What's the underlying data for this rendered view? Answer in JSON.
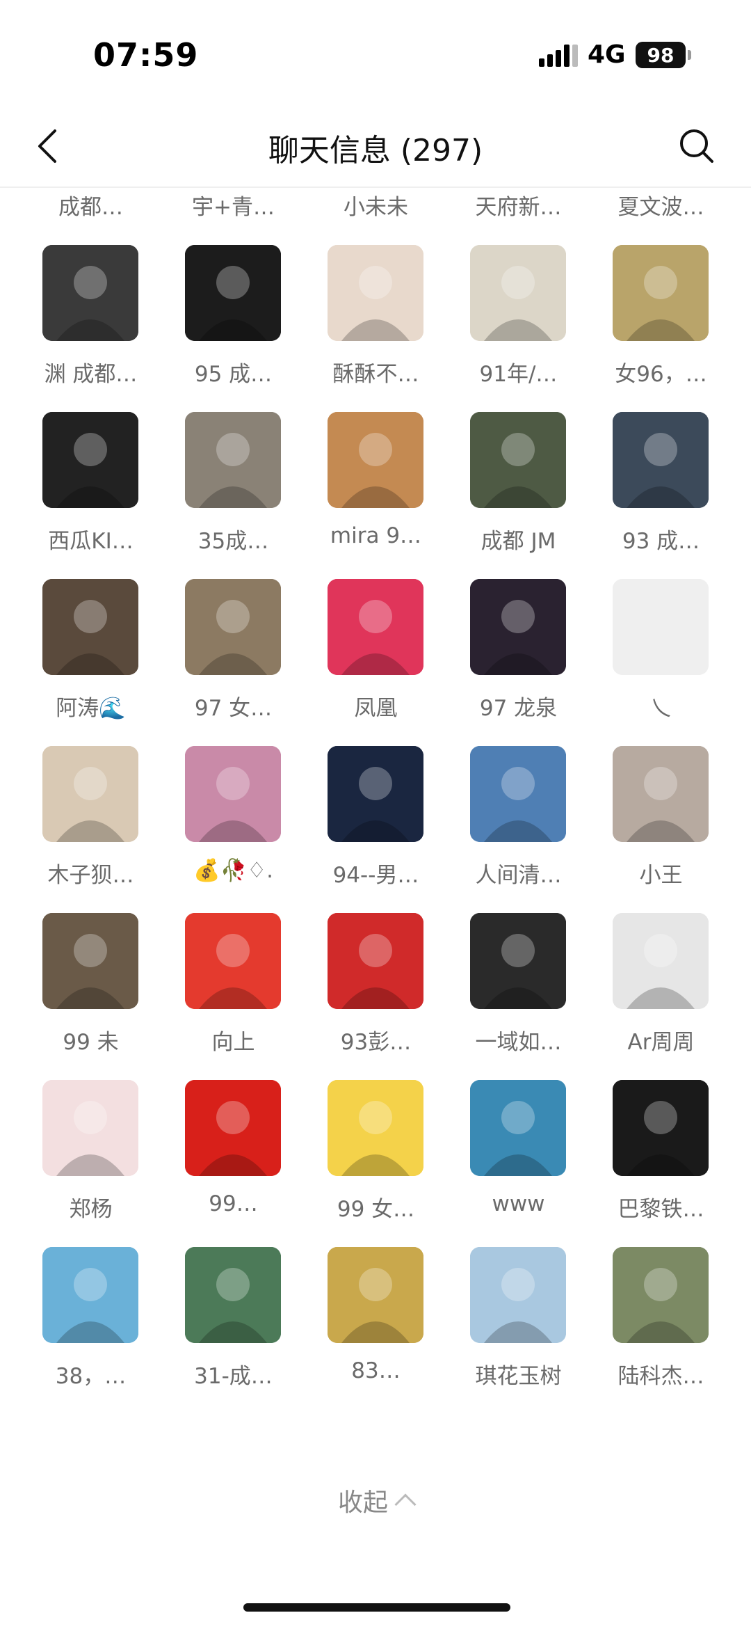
{
  "status_bar": {
    "time": "07:59",
    "network": "4G",
    "battery": "98"
  },
  "header": {
    "title": "聊天信息 (297)"
  },
  "members": [
    {
      "name": "成都…",
      "avatar": "woman-red-dress",
      "color": "#b85a4e"
    },
    {
      "name": "宇+青…",
      "avatar": "cartoon-kid",
      "color": "#f0c24a"
    },
    {
      "name": "小未未",
      "avatar": "cartoon-girl",
      "color": "#f3b24c"
    },
    {
      "name": "天府新…",
      "avatar": "city-sunset",
      "color": "#4a5e7a"
    },
    {
      "name": "夏文波…",
      "avatar": "business-card",
      "color": "#eef0f3"
    },
    {
      "name": "渊 成都…",
      "avatar": "bw-anime-man",
      "color": "#3a3a3a"
    },
    {
      "name": "95 成…",
      "avatar": "man-black-suit",
      "color": "#1c1c1c"
    },
    {
      "name": "酥酥不…",
      "avatar": "woman-portrait",
      "color": "#e8d9cc"
    },
    {
      "name": "91年/…",
      "avatar": "praying-hands",
      "color": "#dcd6c8"
    },
    {
      "name": "女96，…",
      "avatar": "orange-flower",
      "color": "#b9a46a"
    },
    {
      "name": "西瓜KI…",
      "avatar": "man-sunglasses",
      "color": "#222"
    },
    {
      "name": "35成…",
      "avatar": "man-car-selfie",
      "color": "#8a8276"
    },
    {
      "name": "mira 9…",
      "avatar": "hamster",
      "color": "#c48a52"
    },
    {
      "name": "成都 JM",
      "avatar": "man-driving",
      "color": "#4e5a44"
    },
    {
      "name": "93 成…",
      "avatar": "sunset-silhouette",
      "color": "#3c4a5a"
    },
    {
      "name": "阿涛🌊",
      "avatar": "mechanic-engine",
      "color": "#5a4a3c"
    },
    {
      "name": "97 女…",
      "avatar": "woman-street",
      "color": "#8c7a62"
    },
    {
      "name": "凤凰",
      "avatar": "pink-rose",
      "color": "#e0355a"
    },
    {
      "name": "97 龙泉",
      "avatar": "woman-night",
      "color": "#2a2230"
    },
    {
      "name": "乀",
      "avatar": "blank",
      "color": "#efefef"
    },
    {
      "name": "木子狈…",
      "avatar": "kids-sleeping",
      "color": "#d9c9b4"
    },
    {
      "name": "💰🥀♢.",
      "avatar": "blossom-path",
      "color": "#c98aa8"
    },
    {
      "name": "94--男…",
      "avatar": "fireworks",
      "color": "#1a2640"
    },
    {
      "name": "人间清…",
      "avatar": "sky-silhouette",
      "color": "#4f7fb4"
    },
    {
      "name": "小王",
      "avatar": "man-selfie",
      "color": "#b7aaa0"
    },
    {
      "name": "99 未",
      "avatar": "calligraphy-room",
      "color": "#6a5a48"
    },
    {
      "name": "向上",
      "avatar": "red-banner",
      "color": "#e43a2e"
    },
    {
      "name": "93彭…",
      "avatar": "man-new-year",
      "color": "#d02a2a"
    },
    {
      "name": "一域如…",
      "avatar": "glowing-figure",
      "color": "#2a2a2a"
    },
    {
      "name": "Ar周周",
      "avatar": "woman-white-ribbon",
      "color": "#e6e6e6"
    },
    {
      "name": "郑杨",
      "avatar": "anime-girl",
      "color": "#f3dfe0"
    },
    {
      "name": "99…",
      "avatar": "kid-flag",
      "color": "#d8201a"
    },
    {
      "name": "99 女…",
      "avatar": "girl-yellow-hat",
      "color": "#f4d24a"
    },
    {
      "name": "www",
      "avatar": "pavilion",
      "color": "#3a8ab4"
    },
    {
      "name": "巴黎铁…",
      "avatar": "logo-black",
      "color": "#1a1a1a"
    },
    {
      "name": "38，…",
      "avatar": "colorful-painting",
      "color": "#6ab1d8"
    },
    {
      "name": "31-成…",
      "avatar": "mountain-river",
      "color": "#4c7a58"
    },
    {
      "name": "83…",
      "avatar": "jumping-cat",
      "color": "#c9a84c"
    },
    {
      "name": "琪花玉树",
      "avatar": "woman-seagulls",
      "color": "#a9c8e0"
    },
    {
      "name": "陆科杰…",
      "avatar": "woman-white-dress",
      "color": "#7c8a64"
    }
  ],
  "footer": {
    "collapse_label": "收起"
  }
}
